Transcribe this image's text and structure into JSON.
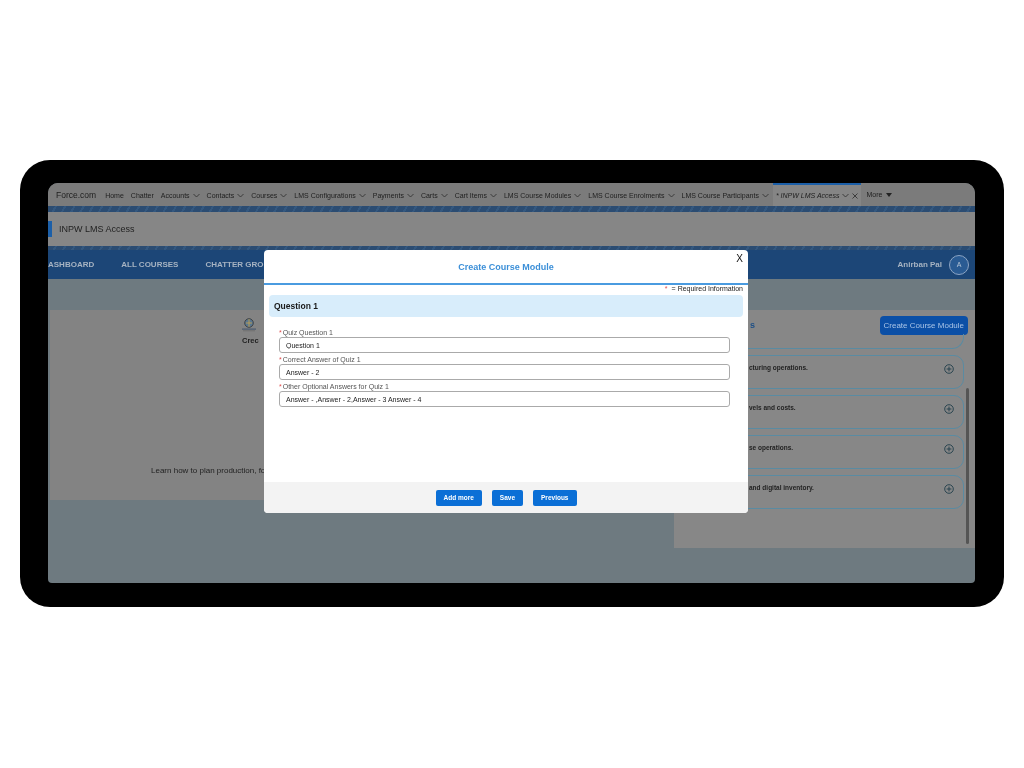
{
  "app_name": "Force.com",
  "tabs": [
    {
      "label": "Home",
      "dropdown": false,
      "selected": false
    },
    {
      "label": "Chatter",
      "dropdown": false,
      "selected": false
    },
    {
      "label": "Accounts",
      "dropdown": true,
      "selected": false
    },
    {
      "label": "Contacts",
      "dropdown": true,
      "selected": false
    },
    {
      "label": "Courses",
      "dropdown": true,
      "selected": false
    },
    {
      "label": "LMS Configurations",
      "dropdown": true,
      "selected": false
    },
    {
      "label": "Payments",
      "dropdown": true,
      "selected": false
    },
    {
      "label": "Carts",
      "dropdown": true,
      "selected": false
    },
    {
      "label": "Cart Items",
      "dropdown": true,
      "selected": false
    },
    {
      "label": "LMS Course Modules",
      "dropdown": true,
      "selected": false
    },
    {
      "label": "LMS Course Enrolments",
      "dropdown": true,
      "selected": false
    },
    {
      "label": "LMS Course Participants",
      "dropdown": true,
      "selected": false
    },
    {
      "label": "* INPW LMS Access",
      "dropdown": true,
      "selected": true
    }
  ],
  "more": "More",
  "page_title": "INPW LMS Access",
  "site_nav": [
    "ASHBOARD",
    "ALL COURSES",
    "CHATTER GRO"
  ],
  "user": {
    "name": "Anirban Pal",
    "initial": "A"
  },
  "course_card": {
    "title": "Crec",
    "description": "Learn how to plan production, fo"
  },
  "modules_panel": {
    "heading": "s",
    "button": "Create Course Module",
    "modules": [
      "cturing operations.",
      "vels and costs.",
      "se operations.",
      "and digital inventory."
    ]
  },
  "modal": {
    "title": "Create Course Module",
    "close": "X",
    "required_mark": "*",
    "required_note": "=  Required Information",
    "section": "Question 1",
    "fields": [
      {
        "marker": "*",
        "label": "Quiz Question 1",
        "value": "Question 1"
      },
      {
        "marker": "*",
        "label": "Correct Answer of Quiz 1",
        "value": "Answer - 2"
      },
      {
        "marker": "*",
        "label": "Other Optional Answers for Quiz 1",
        "value": "Answer - ,Answer - 2,Answer - 3 Answer - 4"
      }
    ],
    "buttons": [
      "Add more",
      "Save",
      "Previous"
    ]
  }
}
